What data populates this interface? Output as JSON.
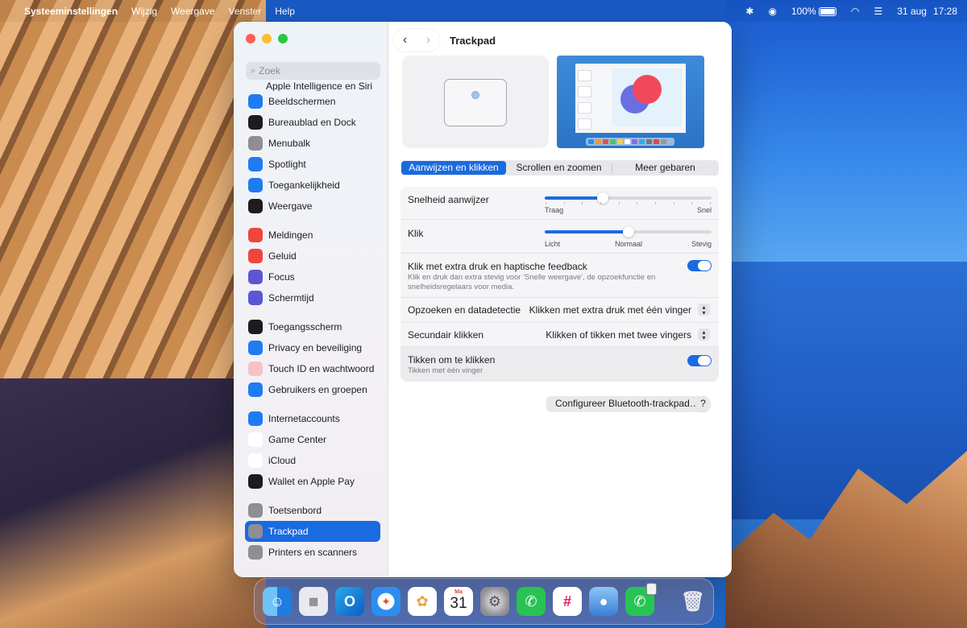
{
  "menubar": {
    "app_name": "Systeeminstellingen",
    "menus": [
      "Wijzig",
      "Weergave",
      "Venster",
      "Help"
    ],
    "battery": "100%",
    "date": "31 aug",
    "time": "17:28"
  },
  "window": {
    "title": "Trackpad",
    "search_placeholder": "Zoek"
  },
  "sidebar": {
    "cut_item": "Apple Intelligence en Siri",
    "groups": [
      [
        {
          "label": "Beeldschermen",
          "icon": "sun-icon",
          "color": "#1f7cf0"
        },
        {
          "label": "Bureaublad en Dock",
          "icon": "dock-icon",
          "color": "#1c1c1e"
        },
        {
          "label": "Menubalk",
          "icon": "menubar-icon",
          "color": "#8e8e93"
        },
        {
          "label": "Spotlight",
          "icon": "search-icon",
          "color": "#1f7cf0"
        },
        {
          "label": "Toegankelijkheid",
          "icon": "accessibility-icon",
          "color": "#1f7cf0"
        },
        {
          "label": "Weergave",
          "icon": "appearance-icon",
          "color": "#1c1c1e"
        }
      ],
      [
        {
          "label": "Meldingen",
          "icon": "bell-icon",
          "color": "#f0453a"
        },
        {
          "label": "Geluid",
          "icon": "speaker-icon",
          "color": "#f0453a"
        },
        {
          "label": "Focus",
          "icon": "moon-icon",
          "color": "#5b56d6"
        },
        {
          "label": "Schermtijd",
          "icon": "hourglass-icon",
          "color": "#5b56d6"
        }
      ],
      [
        {
          "label": "Toegangsscherm",
          "icon": "lock-icon",
          "color": "#1c1c1e"
        },
        {
          "label": "Privacy en beveiliging",
          "icon": "hand-icon",
          "color": "#1f7cf0"
        },
        {
          "label": "Touch ID en wachtwoord",
          "icon": "fingerprint-icon",
          "color": "#f5c2c7"
        },
        {
          "label": "Gebruikers en groepen",
          "icon": "users-icon",
          "color": "#1f7cf0"
        }
      ],
      [
        {
          "label": "Internetaccounts",
          "icon": "at-icon",
          "color": "#1f7cf0"
        },
        {
          "label": "Game Center",
          "icon": "gamecenter-icon",
          "color": "#ffffff"
        },
        {
          "label": "iCloud",
          "icon": "cloud-icon",
          "color": "#ffffff"
        },
        {
          "label": "Wallet en Apple Pay",
          "icon": "wallet-icon",
          "color": "#1c1c1e"
        }
      ],
      [
        {
          "label": "Toetsenbord",
          "icon": "keyboard-icon",
          "color": "#8e8e93"
        },
        {
          "label": "Trackpad",
          "icon": "trackpad-icon",
          "color": "#8e8e93",
          "selected": true
        },
        {
          "label": "Printers en scanners",
          "icon": "printer-icon",
          "color": "#8e8e93"
        }
      ]
    ]
  },
  "tabs": [
    "Aanwijzen en klikken",
    "Scrollen en zoomen",
    "Meer gebaren"
  ],
  "active_tab": 0,
  "settings": {
    "pointer_speed": {
      "label": "Snelheid aanwijzer",
      "min_label": "Traag",
      "max_label": "Snel",
      "value": 0.35
    },
    "click": {
      "label": "Klik",
      "left_label": "Licht",
      "mid_label": "Normaal",
      "right_label": "Stevig",
      "value": 0.5
    },
    "force_click": {
      "label": "Klik met extra druk en haptische feedback",
      "description": "Klik en druk dan extra stevig voor 'Snelle weergave', de opzoekfunctie en snelheidsregelaars voor media.",
      "enabled": true
    },
    "lookup": {
      "label": "Opzoeken en datadetectie",
      "value": "Klikken met extra druk met één vinger"
    },
    "secondary_click": {
      "label": "Secundair klikken",
      "value": "Klikken of tikken met twee vingers"
    },
    "tap_to_click": {
      "label": "Tikken om te klikken",
      "description": "Tikken met één vinger",
      "enabled": true
    }
  },
  "buttons": {
    "bluetooth": "Configureer Bluetooth-trackpad…",
    "help": "?"
  },
  "dock": {
    "calendar_month": "Ma",
    "calendar_day": "31",
    "apps": [
      "Finder",
      "Launchpad",
      "Outlook",
      "Safari",
      "Foto's",
      "Agenda",
      "Systeeminstellingen",
      "WhatsApp",
      "Slack",
      "Finder 2",
      "WhatsApp 2",
      "Prullenmand"
    ]
  }
}
